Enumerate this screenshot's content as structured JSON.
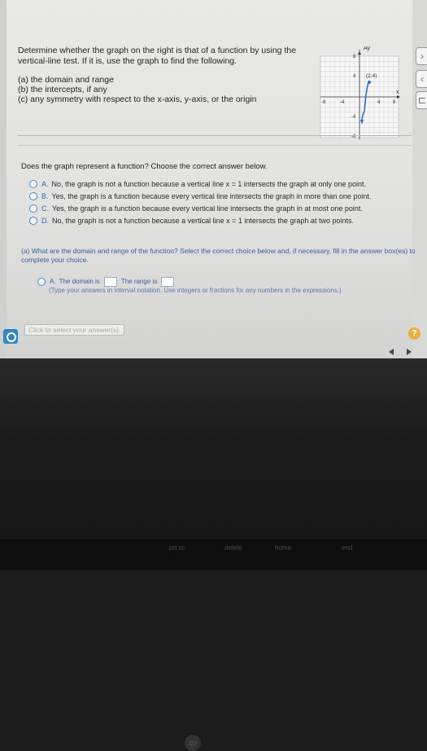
{
  "question": {
    "line1": "Determine whether the graph on the right is that of a function by using the",
    "line2": "vertical-line test. If it is, use the graph to find the following.",
    "parts": [
      "(a) the domain and range",
      "(b) the intercepts, if any",
      "(c) any symmetry with respect to the x-axis, y-axis, or the origin"
    ]
  },
  "graph": {
    "y_axis_label": "Ay",
    "x_axis_label": "x",
    "y_top_tick": "8",
    "y_mid_tick": "4",
    "y_neg_tick": "-4",
    "y_bottom_tick": "-8",
    "x_ticks": [
      "-8",
      "-4",
      "4",
      "8"
    ],
    "point_label": "(2,4)"
  },
  "prompt": "Does the graph represent a function? Choose the correct answer below.",
  "options": [
    {
      "letter": "A.",
      "text": "No, the graph is not a function because a vertical line x = 1 intersects the graph at only one point."
    },
    {
      "letter": "B.",
      "text": "Yes, the graph is a function because every vertical line intersects the graph in more than one point."
    },
    {
      "letter": "C.",
      "text": "Yes, the graph is a function because every vertical line intersects the graph in at most one point."
    },
    {
      "letter": "D.",
      "text": "No, the graph is not a function because a vertical line x = 1 intersects the graph at two points."
    }
  ],
  "sub_question": "(a) What are the domain and range of the function? Select the correct choice below and, if necessary, fill in the answer box(es) to complete your choice.",
  "answer": {
    "letter": "A.",
    "domain_label": "The domain is",
    "range_label": "The range is",
    "hint": "(Type your answers in interval notation. Use integers or fractions for any numbers in the expressions.)"
  },
  "click_select": "Click to select your answer(s).",
  "help": "?",
  "keyboard": [
    "prt sc",
    "delete",
    "home",
    "end"
  ],
  "colors": {
    "accent": "#2e67b1",
    "radio": "#4a86c6",
    "curve": "#2f6fd0"
  }
}
